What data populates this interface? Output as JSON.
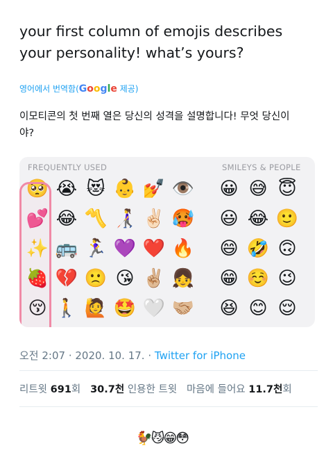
{
  "tweet": {
    "text_line1": "your first column of emojis describes",
    "text_line2": "your personality! what’s yours?"
  },
  "translation": {
    "label_prefix": "영어에서 번역함(",
    "google_g1": "G",
    "google_o1": "o",
    "google_o2": "o",
    "google_g2": "g",
    "google_l": "l",
    "google_e": "e",
    "label_suffix": " 제공)",
    "text_line1": "이모티콘의 첫 번째 열은 당신의 성격을 설명합니다! 무엇 당신이",
    "text_line2": "야?"
  },
  "media": {
    "header_left": "FREQUENTLY USED",
    "header_right": "SMILEYS & PEOPLE",
    "frequently_used": [
      [
        "🥺",
        "😭",
        "😻",
        "👶",
        "💅",
        "👁️"
      ],
      [
        "💕",
        "😂",
        "〽️",
        "👩‍🦯",
        "✌🏻",
        "🥵"
      ],
      [
        "✨",
        "🚌",
        "🏃‍♀️",
        "💜",
        "❤️",
        "🔥"
      ],
      [
        "🍓",
        "💔",
        "🙁",
        "😘",
        "✌🏼",
        "👧"
      ],
      [
        "😚",
        "🚶",
        "🙋",
        "🤩",
        "🤍",
        "🤝🏼"
      ]
    ],
    "smileys": [
      [
        "😀",
        "😅",
        "😇"
      ],
      [
        "😃",
        "😂",
        "🙂"
      ],
      [
        "😄",
        "🤣",
        "🙃"
      ],
      [
        "😁",
        "☺️",
        "😉"
      ],
      [
        "😆",
        "😊",
        "😌"
      ]
    ]
  },
  "meta": {
    "time": "오전 2:07",
    "sep1": " · ",
    "date": "2020. 10. 17.",
    "sep2": " · ",
    "source": "Twitter for iPhone"
  },
  "stats": {
    "retweet_label": "리트윗 ",
    "retweet_count": "691",
    "retweet_unit": "회",
    "quote_count": "30.7천",
    "quote_label": " 인용한 트윗",
    "like_label": "마음에 들어요 ",
    "like_count": "11.7천",
    "like_unit": "회"
  },
  "reply_emojis": "🐓😼😁😳"
}
